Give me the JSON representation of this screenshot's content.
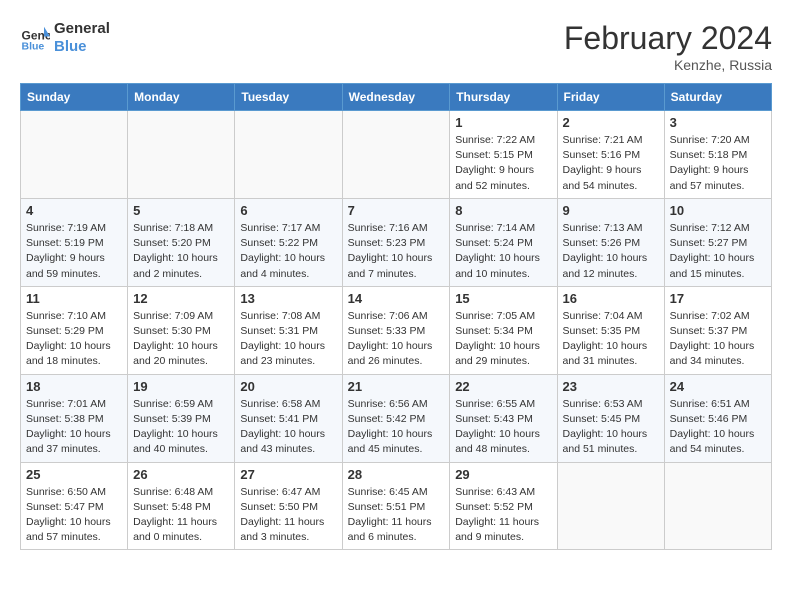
{
  "header": {
    "logo_line1": "General",
    "logo_line2": "Blue",
    "month_year": "February 2024",
    "location": "Kenzhe, Russia"
  },
  "weekdays": [
    "Sunday",
    "Monday",
    "Tuesday",
    "Wednesday",
    "Thursday",
    "Friday",
    "Saturday"
  ],
  "weeks": [
    [
      {
        "day": "",
        "info": ""
      },
      {
        "day": "",
        "info": ""
      },
      {
        "day": "",
        "info": ""
      },
      {
        "day": "",
        "info": ""
      },
      {
        "day": "1",
        "info": "Sunrise: 7:22 AM\nSunset: 5:15 PM\nDaylight: 9 hours\nand 52 minutes."
      },
      {
        "day": "2",
        "info": "Sunrise: 7:21 AM\nSunset: 5:16 PM\nDaylight: 9 hours\nand 54 minutes."
      },
      {
        "day": "3",
        "info": "Sunrise: 7:20 AM\nSunset: 5:18 PM\nDaylight: 9 hours\nand 57 minutes."
      }
    ],
    [
      {
        "day": "4",
        "info": "Sunrise: 7:19 AM\nSunset: 5:19 PM\nDaylight: 9 hours\nand 59 minutes."
      },
      {
        "day": "5",
        "info": "Sunrise: 7:18 AM\nSunset: 5:20 PM\nDaylight: 10 hours\nand 2 minutes."
      },
      {
        "day": "6",
        "info": "Sunrise: 7:17 AM\nSunset: 5:22 PM\nDaylight: 10 hours\nand 4 minutes."
      },
      {
        "day": "7",
        "info": "Sunrise: 7:16 AM\nSunset: 5:23 PM\nDaylight: 10 hours\nand 7 minutes."
      },
      {
        "day": "8",
        "info": "Sunrise: 7:14 AM\nSunset: 5:24 PM\nDaylight: 10 hours\nand 10 minutes."
      },
      {
        "day": "9",
        "info": "Sunrise: 7:13 AM\nSunset: 5:26 PM\nDaylight: 10 hours\nand 12 minutes."
      },
      {
        "day": "10",
        "info": "Sunrise: 7:12 AM\nSunset: 5:27 PM\nDaylight: 10 hours\nand 15 minutes."
      }
    ],
    [
      {
        "day": "11",
        "info": "Sunrise: 7:10 AM\nSunset: 5:29 PM\nDaylight: 10 hours\nand 18 minutes."
      },
      {
        "day": "12",
        "info": "Sunrise: 7:09 AM\nSunset: 5:30 PM\nDaylight: 10 hours\nand 20 minutes."
      },
      {
        "day": "13",
        "info": "Sunrise: 7:08 AM\nSunset: 5:31 PM\nDaylight: 10 hours\nand 23 minutes."
      },
      {
        "day": "14",
        "info": "Sunrise: 7:06 AM\nSunset: 5:33 PM\nDaylight: 10 hours\nand 26 minutes."
      },
      {
        "day": "15",
        "info": "Sunrise: 7:05 AM\nSunset: 5:34 PM\nDaylight: 10 hours\nand 29 minutes."
      },
      {
        "day": "16",
        "info": "Sunrise: 7:04 AM\nSunset: 5:35 PM\nDaylight: 10 hours\nand 31 minutes."
      },
      {
        "day": "17",
        "info": "Sunrise: 7:02 AM\nSunset: 5:37 PM\nDaylight: 10 hours\nand 34 minutes."
      }
    ],
    [
      {
        "day": "18",
        "info": "Sunrise: 7:01 AM\nSunset: 5:38 PM\nDaylight: 10 hours\nand 37 minutes."
      },
      {
        "day": "19",
        "info": "Sunrise: 6:59 AM\nSunset: 5:39 PM\nDaylight: 10 hours\nand 40 minutes."
      },
      {
        "day": "20",
        "info": "Sunrise: 6:58 AM\nSunset: 5:41 PM\nDaylight: 10 hours\nand 43 minutes."
      },
      {
        "day": "21",
        "info": "Sunrise: 6:56 AM\nSunset: 5:42 PM\nDaylight: 10 hours\nand 45 minutes."
      },
      {
        "day": "22",
        "info": "Sunrise: 6:55 AM\nSunset: 5:43 PM\nDaylight: 10 hours\nand 48 minutes."
      },
      {
        "day": "23",
        "info": "Sunrise: 6:53 AM\nSunset: 5:45 PM\nDaylight: 10 hours\nand 51 minutes."
      },
      {
        "day": "24",
        "info": "Sunrise: 6:51 AM\nSunset: 5:46 PM\nDaylight: 10 hours\nand 54 minutes."
      }
    ],
    [
      {
        "day": "25",
        "info": "Sunrise: 6:50 AM\nSunset: 5:47 PM\nDaylight: 10 hours\nand 57 minutes."
      },
      {
        "day": "26",
        "info": "Sunrise: 6:48 AM\nSunset: 5:48 PM\nDaylight: 11 hours\nand 0 minutes."
      },
      {
        "day": "27",
        "info": "Sunrise: 6:47 AM\nSunset: 5:50 PM\nDaylight: 11 hours\nand 3 minutes."
      },
      {
        "day": "28",
        "info": "Sunrise: 6:45 AM\nSunset: 5:51 PM\nDaylight: 11 hours\nand 6 minutes."
      },
      {
        "day": "29",
        "info": "Sunrise: 6:43 AM\nSunset: 5:52 PM\nDaylight: 11 hours\nand 9 minutes."
      },
      {
        "day": "",
        "info": ""
      },
      {
        "day": "",
        "info": ""
      }
    ]
  ]
}
